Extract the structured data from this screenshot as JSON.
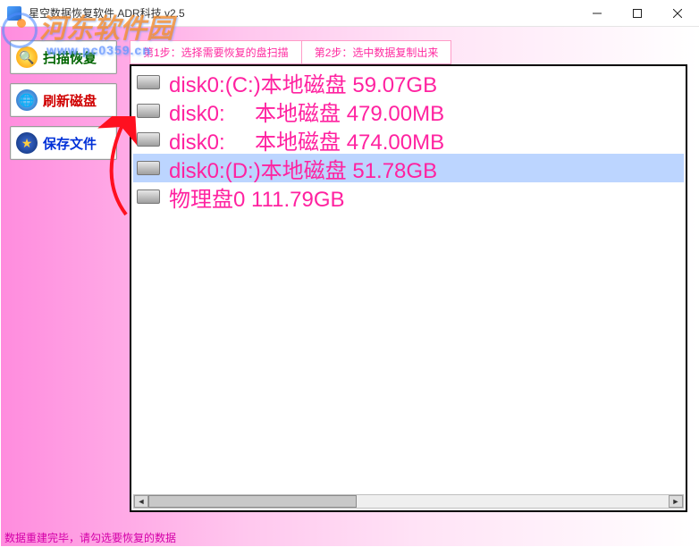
{
  "watermark": {
    "text": "河东软件园",
    "sub": "www.pc0359.cn"
  },
  "titlebar": {
    "title": "星空数据恢复软件      ADR科技 v2.5"
  },
  "sidebar": {
    "buttons": [
      {
        "name": "scan-recover-button",
        "label": "扫描恢复",
        "cls": "green",
        "iconCls": "scan-icon",
        "glyph": "🔍"
      },
      {
        "name": "refresh-disk-button",
        "label": "刷新磁盘",
        "cls": "red",
        "iconCls": "refresh-icon",
        "glyph": "🌐"
      },
      {
        "name": "save-file-button",
        "label": "保存文件",
        "cls": "blue",
        "iconCls": "save-icon",
        "glyph": "★"
      }
    ]
  },
  "steps": {
    "step1": "第1步：选择需要恢复的盘扫描",
    "step2": "第2步：选中数据复制出来"
  },
  "disks": [
    {
      "text": "disk0:(C:)本地磁盘 59.07GB",
      "selected": false
    },
    {
      "text": "disk0:     本地磁盘 479.00MB",
      "selected": false
    },
    {
      "text": "disk0:     本地磁盘 474.00MB",
      "selected": false
    },
    {
      "text": "disk0:(D:)本地磁盘 51.78GB",
      "selected": true
    },
    {
      "text": "物理盘0 111.79GB",
      "selected": false
    }
  ],
  "statusbar": {
    "text": "数据重建完毕，请勾选要恢复的数据"
  }
}
